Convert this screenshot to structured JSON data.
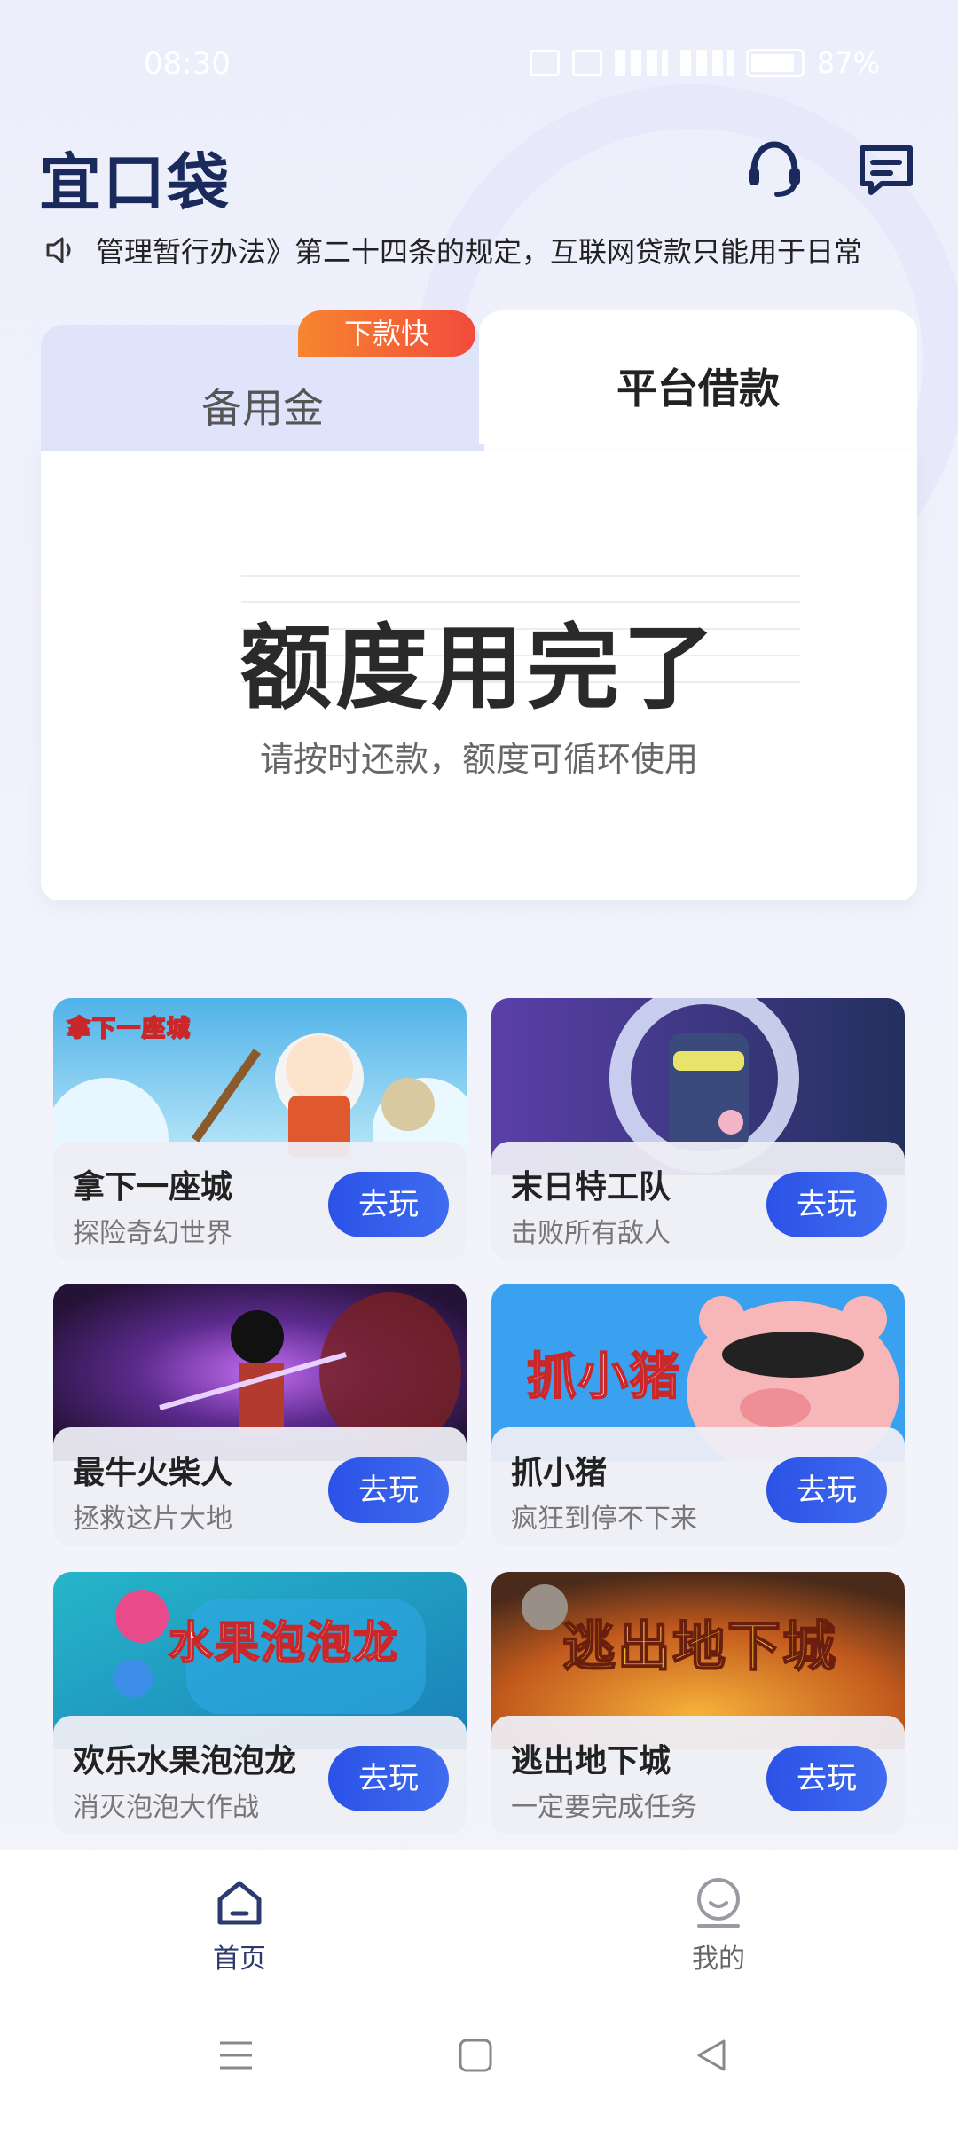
{
  "status_bar": {
    "time": "08:30",
    "battery": "87%"
  },
  "header": {
    "logo": "宜口袋"
  },
  "notice": {
    "text": "管理暂行办法》第二十四条的规定，互联网贷款只能用于日常"
  },
  "loan_card": {
    "tabs": [
      {
        "label": "备用金",
        "badge": "下款快",
        "active": false
      },
      {
        "label": "平台借款",
        "active": true
      }
    ],
    "quota_title": "额度用完了",
    "quota_subtitle": "请按时还款，额度可循环使用"
  },
  "games": [
    {
      "name": "拿下一座城",
      "desc": "探险奇幻世界",
      "art_text": "拿下一座城",
      "button": "去玩"
    },
    {
      "name": "末日特工队",
      "desc": "击败所有敌人",
      "button": "去玩"
    },
    {
      "name": "最牛火柴人",
      "desc": "拯救这片大地",
      "button": "去玩"
    },
    {
      "name": "抓小猪",
      "desc": "疯狂到停不下来",
      "art_text": "抓小猪",
      "button": "去玩"
    },
    {
      "name": "欢乐水果泡泡龙",
      "desc": "消灭泡泡大作战",
      "art_text": "水果泡泡龙",
      "button": "去玩"
    },
    {
      "name": "逃出地下城",
      "desc": "一定要完成任务",
      "art_text": "逃出地下城",
      "button": "去玩"
    }
  ],
  "bottom_nav": [
    {
      "label": "首页",
      "icon": "home-icon",
      "active": true
    },
    {
      "label": "我的",
      "icon": "profile-icon",
      "active": false
    }
  ],
  "colors": {
    "accent": "#2b52e6",
    "badge": "#f24b3c",
    "logo": "#1b2a5c"
  }
}
